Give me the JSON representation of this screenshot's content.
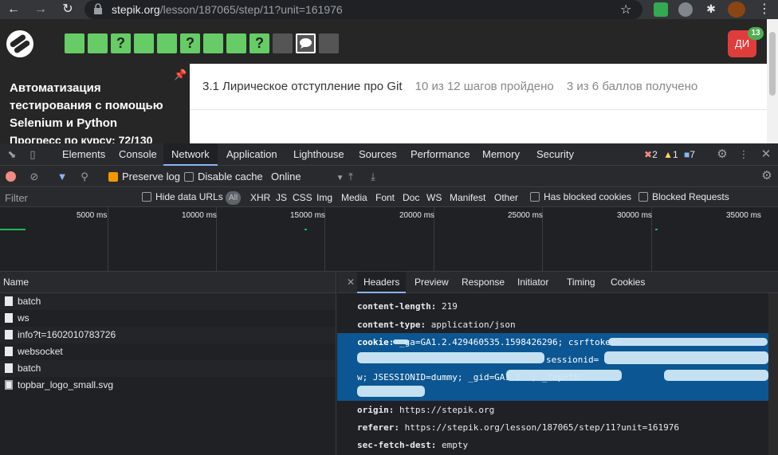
{
  "browser": {
    "url_host": "stepik.org",
    "url_path": "/lesson/187065/step/11?unit=161976"
  },
  "stepik": {
    "steps": [
      "",
      "",
      "?",
      "",
      "",
      "?",
      "",
      "",
      "?",
      "",
      "",
      ""
    ],
    "avatar_initials": "ДИ",
    "notifications": "13",
    "course_title": "Автоматизация тестирования с помощью Selenium и Python",
    "course_progress": "Прогресс по курсу:  72/130",
    "lesson_title": "3.1 Лирическое отступление про Git",
    "steps_done": "10 из 12 шагов пройдено",
    "points": "3 из 6 баллов  получено"
  },
  "devtools": {
    "tabs": [
      "Elements",
      "Console",
      "Network",
      "Application",
      "Lighthouse",
      "Sources",
      "Performance",
      "Memory",
      "Security"
    ],
    "errors": "2",
    "warnings": "1",
    "messages": "7",
    "preserve_log": "Preserve log",
    "disable_cache": "Disable cache",
    "throttle": "Online",
    "filter_placeholder": "Filter",
    "hide_data_urls": "Hide data URLs",
    "all": "All",
    "types": [
      "XHR",
      "JS",
      "CSS",
      "Img",
      "Media",
      "Font",
      "Doc",
      "WS",
      "Manifest",
      "Other"
    ],
    "blocked_cookies": "Has blocked cookies",
    "blocked_requests": "Blocked Requests",
    "timeline_ticks": [
      "5000 ms",
      "10000 ms",
      "15000 ms",
      "20000 ms",
      "25000 ms",
      "30000 ms",
      "35000 ms"
    ],
    "name_header": "Name",
    "requests": [
      "batch",
      "ws",
      "info?t=1602010783726",
      "websocket",
      "batch",
      "topbar_logo_small.svg"
    ],
    "detail_tabs": [
      "Headers",
      "Preview",
      "Response",
      "Initiator",
      "Timing",
      "Cookies"
    ],
    "headers": {
      "content_length_k": "content-length:",
      "content_length_v": "219",
      "content_type_k": "content-type:",
      "content_type_v": "application/json",
      "cookie_k": "cookie:",
      "cookie_line1": "_ga=GA1.2.429460535.1598426296; csrftoken=",
      "cookie_line2": "sessionid=",
      "cookie_line3": "w; JSESSIONID=dummy; _gid=GA1.2.                  ; _fbp=fb.",
      "origin_k": "origin:",
      "origin_v": "https://stepik.org",
      "referer_k": "referer:",
      "referer_v": "https://stepik.org/lesson/187065/step/11?unit=161976",
      "sec_k": "sec-fetch-dest:",
      "sec_v": "empty"
    }
  }
}
